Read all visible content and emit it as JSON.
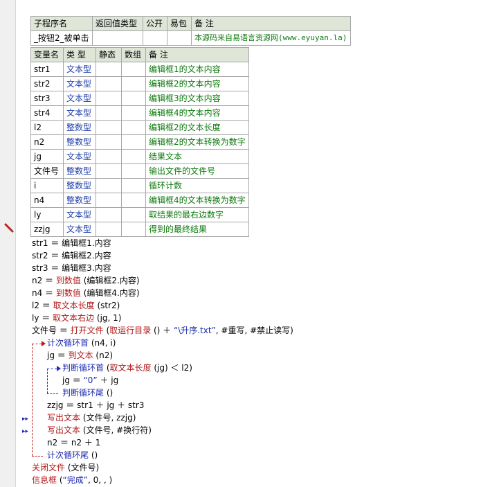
{
  "subroutine_table": {
    "headers": [
      "子程序名",
      "返回值类型",
      "公开",
      "易包",
      "备 注"
    ],
    "row": {
      "name": "_按钮2_被单击",
      "return_type": "",
      "public": "",
      "easy_pack": "",
      "note": "本源码来自易语言资源网(www.eyuyan.la)"
    }
  },
  "variable_table": {
    "headers": [
      "变量名",
      "类 型",
      "静态",
      "数组",
      "备 注"
    ],
    "rows": [
      {
        "name": "str1",
        "type": "文本型",
        "static": "",
        "array": "",
        "note": "编辑框1的文本内容"
      },
      {
        "name": "str2",
        "type": "文本型",
        "static": "",
        "array": "",
        "note": "编辑框2的文本内容"
      },
      {
        "name": "str3",
        "type": "文本型",
        "static": "",
        "array": "",
        "note": "编辑框3的文本内容"
      },
      {
        "name": "str4",
        "type": "文本型",
        "static": "",
        "array": "",
        "note": "编辑框4的文本内容"
      },
      {
        "name": "l2",
        "type": "整数型",
        "static": "",
        "array": "",
        "note": "编辑框2的文本长度"
      },
      {
        "name": "n2",
        "type": "整数型",
        "static": "",
        "array": "",
        "note": "编辑框2的文本转换为数字"
      },
      {
        "name": "jg",
        "type": "文本型",
        "static": "",
        "array": "",
        "note": "结果文本"
      },
      {
        "name": "文件号",
        "type": "整数型",
        "static": "",
        "array": "",
        "note": "输出文件的文件号"
      },
      {
        "name": "i",
        "type": "整数型",
        "static": "",
        "array": "",
        "note": "循环计数"
      },
      {
        "name": "n4",
        "type": "整数型",
        "static": "",
        "array": "",
        "note": "编辑框4的文本转换为数字"
      },
      {
        "name": "ly",
        "type": "文本型",
        "static": "",
        "array": "",
        "note": "取结果的最右边数字"
      },
      {
        "name": "zzjg",
        "type": "文本型",
        "static": "",
        "array": "",
        "note": "得到的最终结果"
      }
    ]
  },
  "code": {
    "l1": {
      "a": "str1 ＝ 编辑框1.内容"
    },
    "l2": {
      "a": "str2 ＝ 编辑框2.内容"
    },
    "l3": {
      "a": "str3 ＝ 编辑框3.内容"
    },
    "l4": {
      "a": "n2 ＝ ",
      "kw": "到数值",
      "b": " (编辑框2.内容)"
    },
    "l5": {
      "a": "n4 ＝ ",
      "kw": "到数值",
      "b": " (编辑框4.内容)"
    },
    "l6": {
      "a": "l2 ＝ ",
      "kw": "取文本长度",
      "b": " (str2)"
    },
    "l7": {
      "a": "ly ＝ ",
      "kw": "取文本右边",
      "b": " (jg, 1)"
    },
    "l8": {
      "a": "文件号 ＝ ",
      "kw": "打开文件",
      "b": " (",
      "kw2": "取运行目录",
      "c": " () ＋ ",
      "s": "“\\升序.txt”",
      "d": ", #重写, #禁止读写)"
    },
    "l9": {
      "fl": "计次循环首",
      "b": " (n4, i)"
    },
    "l10": {
      "a": "jg ＝ ",
      "kw": "到文本",
      "b": " (n2)"
    },
    "l11": {
      "fl": "判断循环首",
      "b": " (",
      "kw": "取文本长度",
      "c": " (jg) ＜ l2)"
    },
    "l12": {
      "a": "jg ＝ ",
      "s": "“0”",
      "b": " ＋ jg"
    },
    "l13": {
      "fl": "判断循环尾",
      "b": " ()"
    },
    "l14": {
      "a": "zzjg ＝ str1 ＋ jg ＋ str3"
    },
    "l15": {
      "kw": "写出文本",
      "b": " (文件号, zzjg)"
    },
    "l16": {
      "kw": "写出文本",
      "b": " (文件号, #换行符)"
    },
    "l17": {
      "a": "n2 ＝ n2 ＋ 1"
    },
    "l18": {
      "fl": "计次循环尾",
      "b": " ()"
    },
    "l19": {
      "kw": "关闭文件",
      "b": " (文件号)"
    },
    "l20": {
      "kw": "信息框",
      "b": " (",
      "s": "“完成”",
      "c": ", 0, , )"
    }
  },
  "breakpoint_glyph": "▸▸",
  "colors": {
    "header_bg": "#dfe6d8",
    "type_blue": "#1f3fa8",
    "note_green": "#0d7a0d",
    "keyword_red": "#b11a1a",
    "flow_blue": "#1b28b0"
  },
  "icons": {
    "pencil": "pencil-icon",
    "breakpoint": "breakpoint-icon"
  }
}
